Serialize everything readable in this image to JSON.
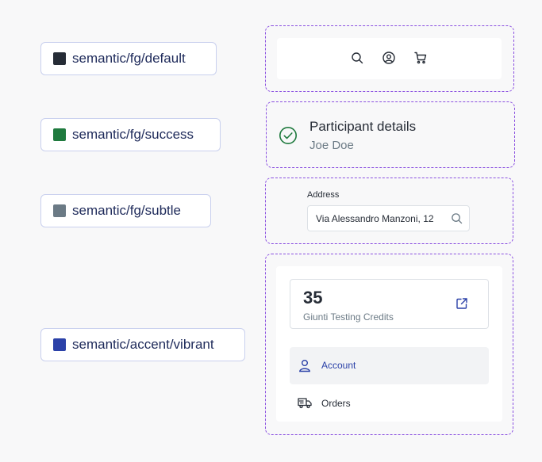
{
  "tokens": [
    {
      "label": "semantic/fg/default",
      "color": "#262c36"
    },
    {
      "label": "semantic/fg/success",
      "color": "#1f7a3e"
    },
    {
      "label": "semantic/fg/subtle",
      "color": "#6b7a85"
    },
    {
      "label": "semantic/accent/vibrant",
      "color": "#2b41a8"
    }
  ],
  "header": {
    "icons": [
      "search-icon",
      "user-circle-icon",
      "cart-icon"
    ]
  },
  "participant": {
    "title": "Participant details",
    "name": "Joe Doe",
    "icon": "check-circle-icon"
  },
  "address": {
    "label": "Address",
    "value": "Via Alessandro Manzoni, 12",
    "icon": "search-icon"
  },
  "credits": {
    "count": "35",
    "label": "Giunti Testing Credits",
    "icon": "external-link-icon"
  },
  "menu": {
    "items": [
      {
        "label": "Account",
        "icon": "user-icon",
        "active": true
      },
      {
        "label": "Orders",
        "icon": "truck-icon",
        "active": false
      }
    ]
  }
}
